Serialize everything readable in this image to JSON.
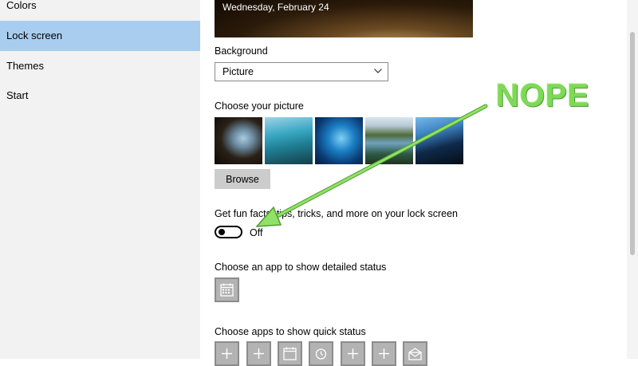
{
  "sidebar": {
    "items": [
      {
        "label": "Colors",
        "selected": false
      },
      {
        "label": "Lock screen",
        "selected": true
      },
      {
        "label": "Themes",
        "selected": false
      },
      {
        "label": "Start",
        "selected": false
      }
    ]
  },
  "preview": {
    "date": "Wednesday, February 24"
  },
  "background": {
    "label": "Background",
    "value": "Picture"
  },
  "choose_picture": {
    "label": "Choose your picture",
    "browse_label": "Browse"
  },
  "fun_facts": {
    "label": "Get fun facts, tips, tricks, and more on your lock screen",
    "state": "Off"
  },
  "detailed_status": {
    "label": "Choose an app to show detailed status",
    "icon": "calendar-icon"
  },
  "quick_status": {
    "label": "Choose apps to show quick status",
    "icons": [
      "plus-icon",
      "plus-icon",
      "calendar-icon",
      "alarm-icon",
      "plus-icon",
      "plus-icon",
      "mail-icon"
    ]
  },
  "annotation": {
    "text": "NOPE",
    "color": "#7ed957"
  },
  "colors": {
    "selection": "#a9cdee",
    "sidebar_bg": "#f2f2f2"
  }
}
